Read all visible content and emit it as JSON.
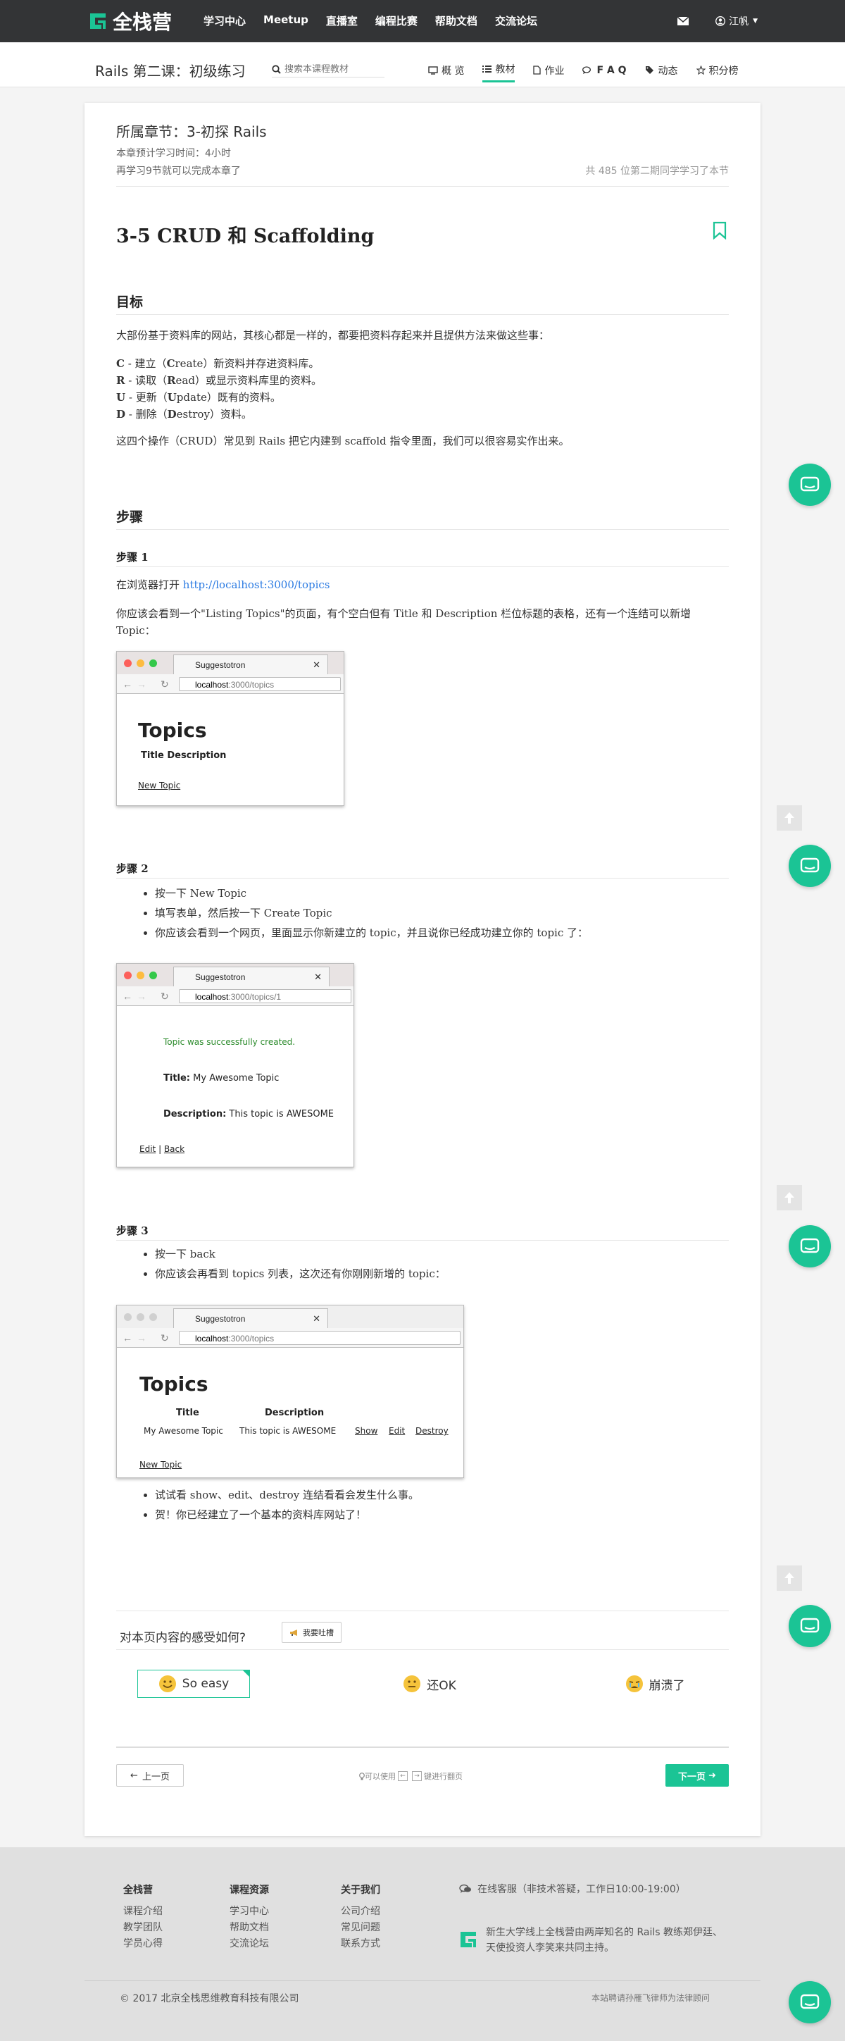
{
  "topnav": {
    "logo_text": "全栈营",
    "links": [
      "学习中心",
      "Meetup",
      "直播室",
      "编程比赛",
      "帮助文档",
      "交流论坛"
    ],
    "user_name": "江帆"
  },
  "coursebar": {
    "title": "Rails 第二课：初级练习",
    "search_placeholder": "搜索本课程教材",
    "tabs": [
      "概 览",
      "教材",
      "作业",
      "F A Q",
      "动态",
      "积分榜"
    ]
  },
  "lesson": {
    "chapter": "所属章节：3-初探 Rails",
    "estimate": "本章预计学习时间：4小时",
    "remaining": "再学习9节就可以完成本章了",
    "learners": "共 485 位第二期同学学习了本节",
    "title": "3-5 CRUD 和 Scaffolding"
  },
  "content": {
    "goal_heading": "目标",
    "goal_intro": "大部份基于资料库的网站，其核心都是一样的，都要把资料存起来并且提供方法来做这些事：",
    "crud": [
      {
        "letter": "C",
        "pre": " - 建立（",
        "word": "C",
        "rest": "reate）新资料并存进资料库。"
      },
      {
        "letter": "R",
        "pre": " - 读取（",
        "word": "R",
        "rest": "ead）或显示资料库里的资料。"
      },
      {
        "letter": "U",
        "pre": " - 更新（",
        "word": "U",
        "rest": "pdate）既有的资料。"
      },
      {
        "letter": "D",
        "pre": " - 删除（",
        "word": "D",
        "rest": "estroy）资料。"
      }
    ],
    "crud_outro": "这四个操作（CRUD）常见到 Rails 把它内建到 scaffold 指令里面，我们可以很容易实作出来。",
    "steps_heading": "步骤",
    "step1": {
      "heading": "步骤 1",
      "open_prefix": "在浏览器打开 ",
      "open_link": "http://localhost:3000/topics",
      "desc": "你应该会看到一个\"Listing Topics\"的页面，有个空白但有 Title 和 Description 栏位标题的表格，还有一个连结可以新增 Topic："
    },
    "step2": {
      "heading": "步骤 2",
      "items": [
        "按一下 New Topic",
        "填写表单，然后按一下 Create Topic",
        "你应该会看到一个网页，里面显示你新建立的 topic，并且说你已经成功建立你的 topic 了："
      ]
    },
    "step3": {
      "heading": "步骤 3",
      "items": [
        "按一下 back",
        "你应该会再看到 topics 列表，这次还有你刚刚新增的 topic："
      ],
      "items_after": [
        "试试看 show、edit、destroy 连结看看会发生什么事。",
        "贺！你已经建立了一个基本的资料库网站了！"
      ]
    }
  },
  "shots": {
    "tab_label": "Suggestotron",
    "shot1": {
      "host": "localhost",
      "path": ":3000/topics",
      "title": "Topics",
      "header": "Title Description",
      "link": "New Topic"
    },
    "shot2": {
      "host": "localhost",
      "path": ":3000/topics/1",
      "notice": "Topic was successfully created.",
      "title_label": "Title:",
      "title_value": "My Awesome Topic",
      "desc_label": "Description:",
      "desc_value": "This topic is AWESOME",
      "edit": "Edit",
      "sep": "|",
      "back": "Back"
    },
    "shot3": {
      "host": "localhost",
      "path": ":3000/topics",
      "title": "Topics",
      "col_title": "Title",
      "col_desc": "Description",
      "row_title": "My Awesome Topic",
      "row_desc": "This topic is AWESOME",
      "show": "Show",
      "edit": "Edit",
      "destroy": "Destroy",
      "link": "New Topic"
    }
  },
  "feedback": {
    "question": "对本页内容的感受如何?",
    "complain": "我要吐槽",
    "options": [
      "So easy",
      "还OK",
      "崩溃了"
    ]
  },
  "pager": {
    "prev": "上一页",
    "hint_pre": "可以使用",
    "hint_post": "键进行翻页",
    "next": "下一页"
  },
  "footer": {
    "col1": {
      "title": "全栈营",
      "items": [
        "课程介绍",
        "教学团队",
        "学员心得"
      ]
    },
    "col2": {
      "title": "课程资源",
      "items": [
        "学习中心",
        "帮助文档",
        "交流论坛"
      ]
    },
    "col3": {
      "title": "关于我们",
      "items": [
        "公司介绍",
        "常见问题",
        "联系方式"
      ]
    },
    "service": "在线客服（非技术答疑，工作日10:00-19:00）",
    "desc": "新生大学线上全栈营由两岸知名的 Rails 教练郑伊廷、天使投资人李笑来共同主持。",
    "copyright": "© 2017 北京全栈思维教育科技有限公司",
    "legal": "本站聘请孙雁飞律师为法律顾问"
  },
  "colors": {
    "accent": "#1bc495",
    "nav_bg": "#333436",
    "link": "#2a7ae2"
  }
}
